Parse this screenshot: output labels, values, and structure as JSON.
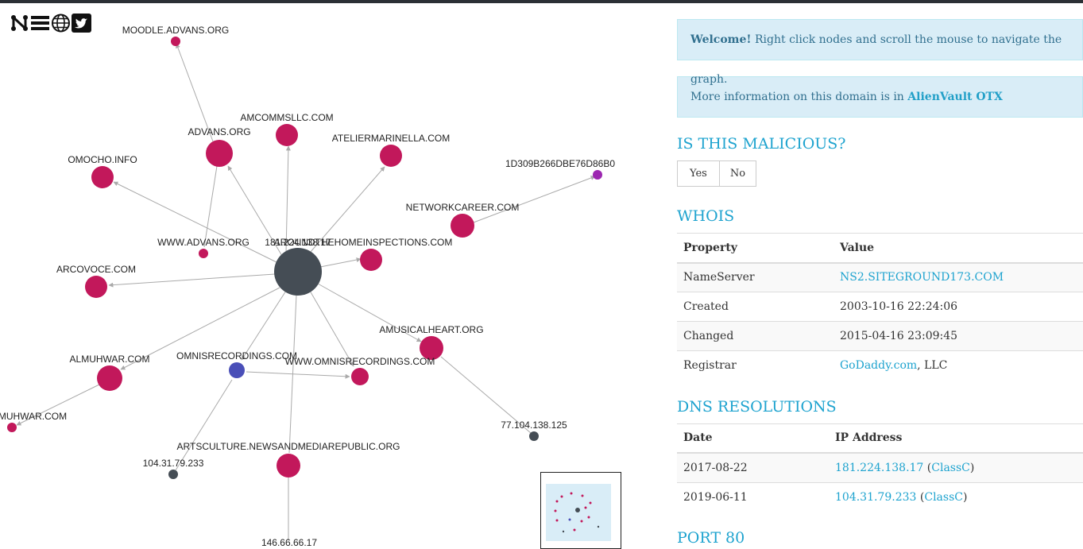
{
  "graph": {
    "center_label": "181.224.138.17",
    "nodes": [
      {
        "label": "MOODLE.ADVANS.ORG",
        "color": "#c2185b"
      },
      {
        "label": "AMCOMMSLLC.COM",
        "color": "#c2185b"
      },
      {
        "label": "ADVANS.ORG",
        "color": "#c2185b"
      },
      {
        "label": "ATELIERMARINELLA.COM",
        "color": "#c2185b"
      },
      {
        "label": "OMOCHO.INFO",
        "color": "#c2185b"
      },
      {
        "label": "1D309B266DBE76D86B0",
        "color": "#9c27b0"
      },
      {
        "label": "NETWORKCAREER.COM",
        "color": "#c2185b"
      },
      {
        "label": "WWW.ADVANS.ORG",
        "color": "#c2185b"
      },
      {
        "label": "AROUNDTHEHOMEINSPECTIONS.COM",
        "color": "#c2185b"
      },
      {
        "label": "ARCOVOCE.COM",
        "color": "#c2185b"
      },
      {
        "label": "AMUSICALHEART.ORG",
        "color": "#c2185b"
      },
      {
        "label": "ALMUHWAR.COM",
        "color": "#c2185b"
      },
      {
        "label": "OMNISRECORDINGS.COM",
        "color": "#4a4fb8"
      },
      {
        "label": "WWW.OMNISRECORDINGS.COM",
        "color": "#c2185b"
      },
      {
        "label": "MUHWAR.COM",
        "color": "#c2185b"
      },
      {
        "label": "77.104.138.125",
        "color": "#454d55"
      },
      {
        "label": "ARTSCULTURE.NEWSANDMEDIAREPUBLIC.ORG",
        "color": "#c2185b"
      },
      {
        "label": "104.31.79.233",
        "color": "#454d55"
      },
      {
        "label": "146.66.66.17",
        "color": "#454d55"
      }
    ]
  },
  "logo_icons": [
    "neo-logo-icon",
    "list-icon",
    "globe-icon",
    "twitter-icon"
  ],
  "welcome": {
    "strong": "Welcome!",
    "text": " Right click nodes and scroll the mouse to navigate the graph."
  },
  "info": {
    "text": "More information on this domain is in ",
    "link": "AlienVault OTX"
  },
  "malicious": {
    "heading": "IS THIS MALICIOUS?",
    "yes": "Yes",
    "no": "No"
  },
  "whois": {
    "heading": "WHOIS",
    "col_property": "Property",
    "col_value": "Value",
    "rows": [
      {
        "property": "NameServer",
        "value": "NS2.SITEGROUND173.COM"
      },
      {
        "property": "Created",
        "value": "2003-10-16 22:24:06"
      },
      {
        "property": "Changed",
        "value": "2015-04-16 23:09:45"
      },
      {
        "property": "Registrar",
        "value_link": "GoDaddy.com",
        "value_rest": ", LLC"
      }
    ]
  },
  "dns": {
    "heading": "DNS RESOLUTIONS",
    "col_date": "Date",
    "col_ip": "IP Address",
    "rows": [
      {
        "date": "2017-08-22",
        "ip": "181.224.138.17",
        "class": "ClassC"
      },
      {
        "date": "2019-06-11",
        "ip": "104.31.79.233",
        "class": "ClassC"
      }
    ]
  },
  "port": {
    "heading": "PORT 80"
  },
  "colors": {
    "accent": "#1ea3cf",
    "alert_bg": "#d9edf7",
    "node_pink": "#c2185b",
    "node_dark": "#454d55"
  }
}
